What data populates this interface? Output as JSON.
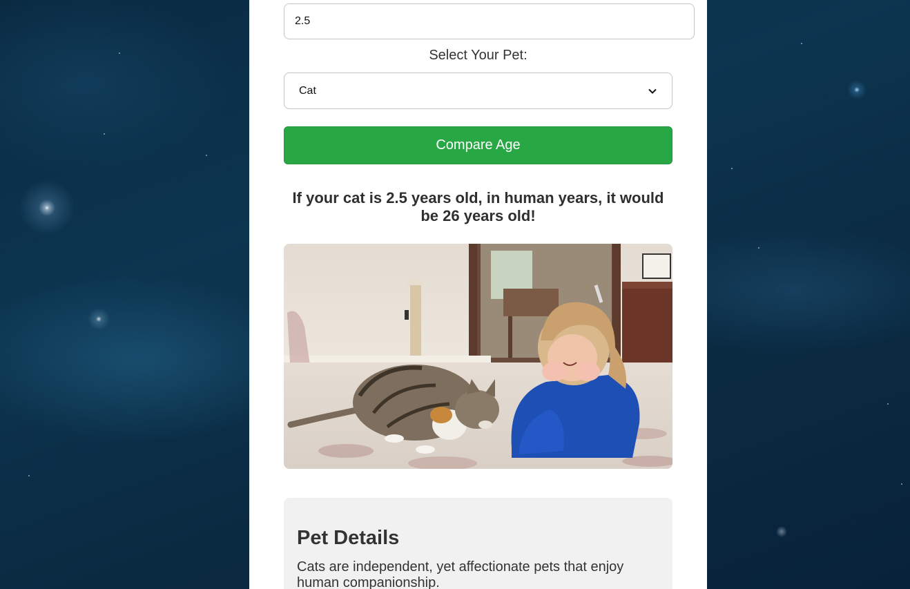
{
  "form": {
    "age_value": "2.5",
    "pet_label": "Select Your Pet:",
    "pet_selected": "Cat",
    "compare_button": "Compare Age"
  },
  "result": {
    "text": "If your cat is 2.5 years old, in human years, it would be 26 years old!"
  },
  "photo": {
    "icon": "cat-and-girl-photo"
  },
  "details": {
    "title": "Pet Details",
    "description": "Cats are independent, yet affectionate pets that enjoy human companionship."
  },
  "colors": {
    "accent_button": "#28a745",
    "panel_bg": "#ffffff",
    "details_bg": "#f1f1f1",
    "space_bg": "#0b2c44"
  }
}
